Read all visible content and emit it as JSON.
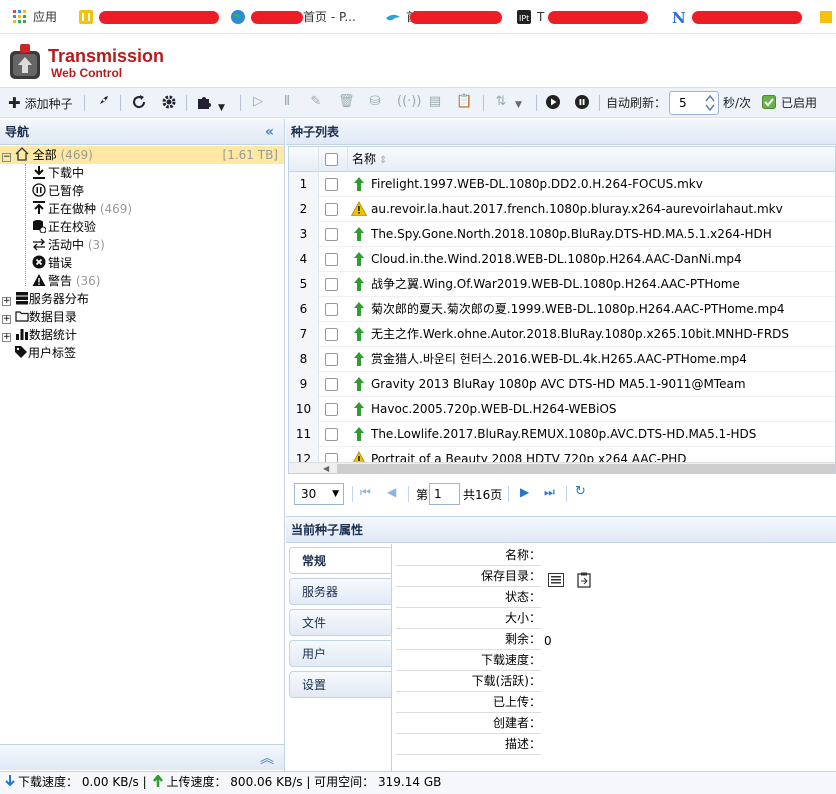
{
  "bookmarks": [
    {
      "label": "应用",
      "icon": "apps-grid-icon"
    },
    {
      "label": "首页 - P...",
      "icon": "globe-icon"
    },
    {
      "label": "首",
      "icon": "bird-icon"
    },
    {
      "label": "T",
      "icon": "ipt-icon"
    }
  ],
  "app": {
    "title": "Transmission",
    "subtitle": "Web Control"
  },
  "toolbar": {
    "add_label": "添加种子",
    "auto_refresh_label": "自动刷新：",
    "refresh_interval": "5",
    "interval_unit": "秒/次",
    "enabled_label": "已启用"
  },
  "nav": {
    "title": "导航",
    "all": {
      "label": "全部",
      "count": "(469)",
      "size": "[1.61 TB]"
    },
    "children": [
      {
        "label": "下载中",
        "count": ""
      },
      {
        "label": "已暂停",
        "count": ""
      },
      {
        "label": "正在做种",
        "count": "(469)"
      },
      {
        "label": "正在校验",
        "count": ""
      },
      {
        "label": "活动中",
        "count": "(3)"
      },
      {
        "label": "错误",
        "count": ""
      },
      {
        "label": "警告",
        "count": "(36)"
      }
    ],
    "groups": [
      {
        "label": "服务器分布"
      },
      {
        "label": "数据目录"
      },
      {
        "label": "数据统计"
      },
      {
        "label": "用户标签"
      }
    ]
  },
  "list": {
    "title": "种子列表",
    "name_header": "名称",
    "rows": [
      {
        "n": "1",
        "status": "up",
        "name": "Firelight.1997.WEB-DL.1080p.DD2.0.H.264-FOCUS.mkv"
      },
      {
        "n": "2",
        "status": "warn",
        "name": "au.revoir.la.haut.2017.french.1080p.bluray.x264-aurevoirlahaut.mkv"
      },
      {
        "n": "3",
        "status": "up",
        "name": "The.Spy.Gone.North.2018.1080p.BluRay.DTS-HD.MA.5.1.x264-HDH"
      },
      {
        "n": "4",
        "status": "up",
        "name": "Cloud.in.the.Wind.2018.WEB-DL.1080p.H264.AAC-DanNi.mp4"
      },
      {
        "n": "5",
        "status": "up",
        "name": "战争之翼.Wing.Of.War2019.WEB-DL.1080p.H264.AAC-PTHome"
      },
      {
        "n": "6",
        "status": "up",
        "name": "菊次郎的夏天.菊次郎の夏.1999.WEB-DL.1080p.H264.AAC-PTHome.mp4"
      },
      {
        "n": "7",
        "status": "up",
        "name": "无主之作.Werk.ohne.Autor.2018.BluRay.1080p.x265.10bit.MNHD-FRDS"
      },
      {
        "n": "8",
        "status": "up",
        "name": "赏金猎人.바운티 헌터스.2016.WEB-DL.4k.H265.AAC-PTHome.mp4"
      },
      {
        "n": "9",
        "status": "up",
        "name": "Gravity 2013 BluRay 1080p AVC DTS-HD MA5.1-9011@MTeam"
      },
      {
        "n": "10",
        "status": "up",
        "name": "Havoc.2005.720p.WEB-DL.H264-WEBiOS"
      },
      {
        "n": "11",
        "status": "up",
        "name": "The.Lowlife.2017.BluRay.REMUX.1080p.AVC.DTS-HD.MA5.1-HDS"
      },
      {
        "n": "12",
        "status": "warn",
        "name": "Portrait of a Beauty 2008 HDTV 720p x264 AAC-PHD"
      }
    ]
  },
  "pager": {
    "page_size": "30",
    "page_prefix": "第",
    "page": "1",
    "total": "共16页"
  },
  "props": {
    "title": "当前种子属性",
    "tabs": [
      "常规",
      "服务器",
      "文件",
      "用户",
      "设置"
    ],
    "fields": [
      {
        "label": "名称：",
        "value": ""
      },
      {
        "label": "保存目录：",
        "value": ""
      },
      {
        "label": "状态：",
        "value": ""
      },
      {
        "label": "大小：",
        "value": ""
      },
      {
        "label": "剩余：",
        "value": "0"
      },
      {
        "label": "下载速度：",
        "value": ""
      },
      {
        "label": "下载(活跃)：",
        "value": ""
      },
      {
        "label": "已上传：",
        "value": ""
      },
      {
        "label": "创建者：",
        "value": ""
      },
      {
        "label": "描述：",
        "value": ""
      }
    ]
  },
  "status": {
    "down_label": "下载速度：",
    "down": "0.00 KB/s",
    "up_label": "上传速度：",
    "up": "800.06 KB/s",
    "free_label": "可用空间：",
    "free": "319.14 GB"
  },
  "colors": {
    "brand": "#b71c1c",
    "up_arrow": "#2e9e2e",
    "warn": "#f2c200",
    "accent": "#1f78d1"
  }
}
